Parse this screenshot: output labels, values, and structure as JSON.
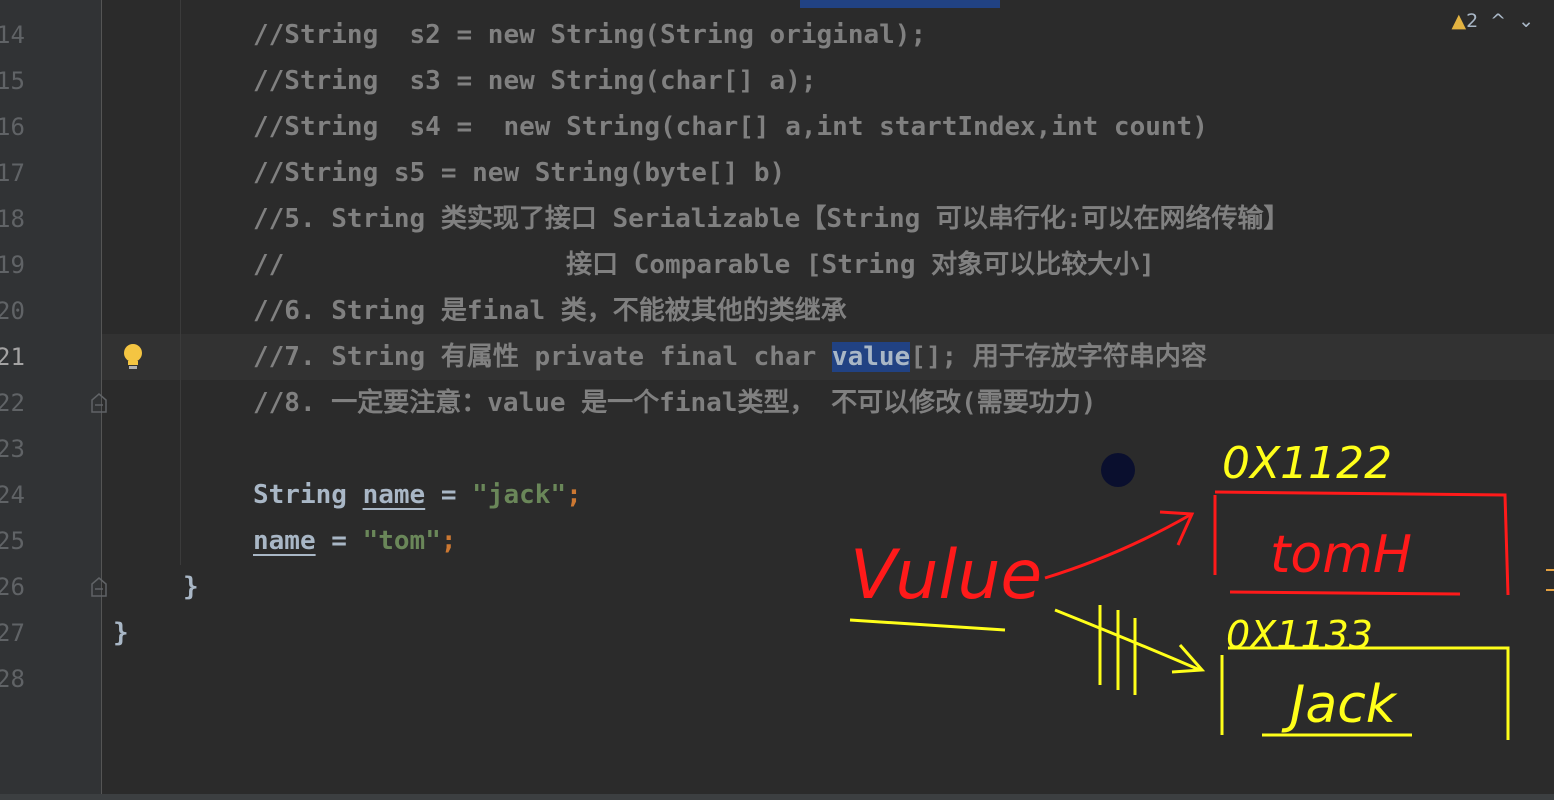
{
  "warnings": {
    "count": "2",
    "up": "^",
    "down": "⌄"
  },
  "line_numbers": [
    "14",
    "15",
    "16",
    "17",
    "18",
    "19",
    "20",
    "21",
    "22",
    "23",
    "24",
    "25",
    "26",
    "27",
    "28"
  ],
  "code": {
    "l14": "//String  s2 = new String(String original);",
    "l15": "//String  s3 = new String(char[] a);",
    "l16": "//String  s4 =  new String(char[] a,int startIndex,int count)",
    "l17": "//String s5 = new String(byte[] b)",
    "l18": "//5. String 类实现了接口 Serializable【String 可以串行化:可以在网络传输】",
    "l19": "//                  接口 Comparable [String 对象可以比较大小]",
    "l20": "//6. String 是final 类，不能被其他的类继承",
    "l21_a": "//7. String 有属性 private final char ",
    "l21_b": "value",
    "l21_c": "[]; 用于存放字符串内容",
    "l22": "//8. 一定要注意：value 是一个final类型， 不可以修改(需要功力)",
    "l24_type": "String",
    "l24_var": "name",
    "l24_eq": " = ",
    "l24_str": "\"jack\"",
    "l24_semi": ";",
    "l25_var": "name",
    "l25_eq": " = ",
    "l25_str": "\"tom\"",
    "l25_semi": ";",
    "l26": "}",
    "l27": "}"
  },
  "annotations": {
    "addr1": "0X1122",
    "addr2": "0X1133",
    "value_label": "Vulue",
    "box1_content": "tomH",
    "box2_content": "Jack"
  },
  "colors": {
    "red": "#ff1a1a",
    "yellow": "#ffff1a",
    "highlight": "#214283"
  }
}
